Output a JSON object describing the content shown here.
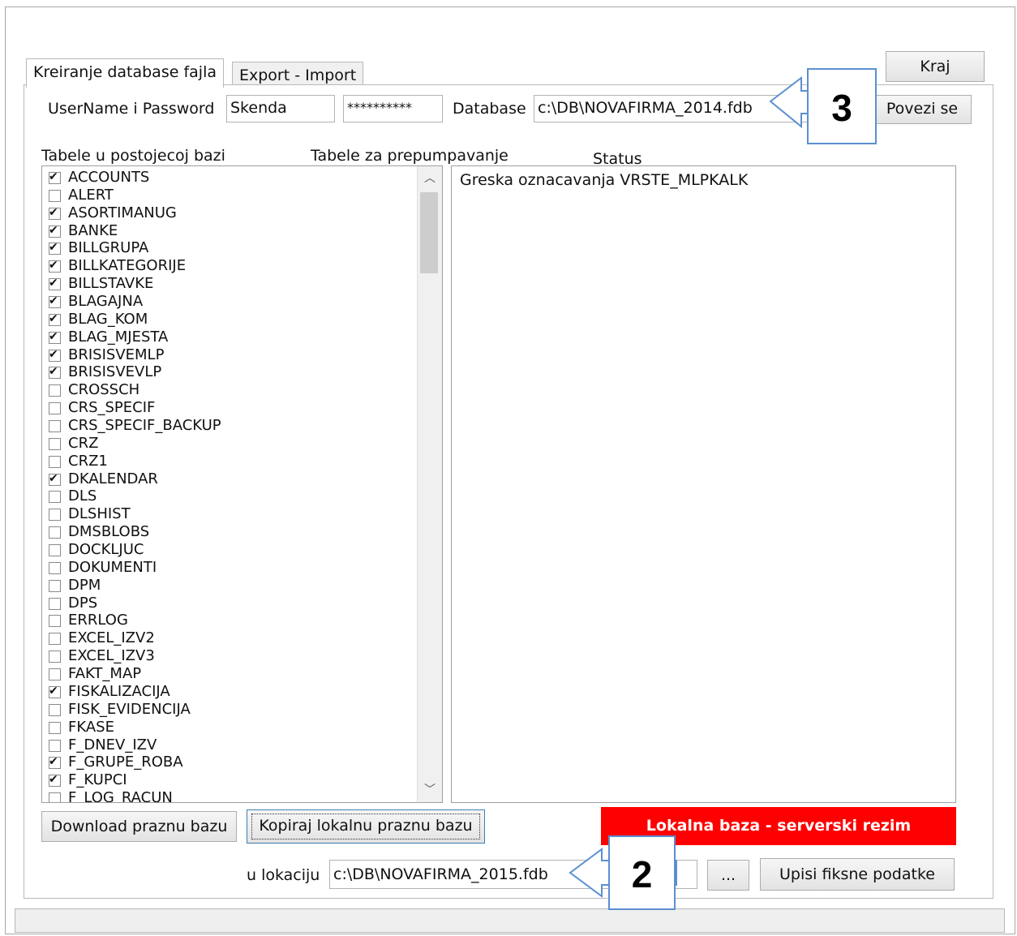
{
  "tabs": [
    "Kreiranje database fajla",
    "Export - Import"
  ],
  "kraj_label": "Kraj",
  "userpass_label": "UserName i Password",
  "username_value": "Skenda",
  "password_value": "**********",
  "database_label": "Database",
  "database_value": "c:\\DB\\NOVAFIRMA_2014.fdb",
  "povezi_label": "Povezi se",
  "col_existing": "Tabele u postojecoj bazi",
  "col_pump": "Tabele za prepumpavanje",
  "col_status": "Status",
  "status_text": "Greska oznacavanja VRSTE_MLPKALK",
  "download_label": "Download praznu bazu",
  "kopiraj_label": "Kopiraj lokalnu praznu bazu",
  "banner_text": "Lokalna baza - serverski rezim",
  "lokacija_label": "u lokaciju",
  "lokacija_value": "c:\\DB\\NOVAFIRMA_2015.fdb",
  "browse_label": "...",
  "upisi_label": "Upisi fiksne podatke",
  "callout_3": "3",
  "callout_2": "2",
  "tables": [
    {
      "name": "ACCOUNTS",
      "checked": true
    },
    {
      "name": "ALERT",
      "checked": false
    },
    {
      "name": "ASORTIMANUG",
      "checked": true
    },
    {
      "name": "BANKE",
      "checked": true
    },
    {
      "name": "BILLGRUPA",
      "checked": true
    },
    {
      "name": "BILLKATEGORIJE",
      "checked": true
    },
    {
      "name": "BILLSTAVKE",
      "checked": true
    },
    {
      "name": "BLAGAJNA",
      "checked": true
    },
    {
      "name": "BLAG_KOM",
      "checked": true
    },
    {
      "name": "BLAG_MJESTA",
      "checked": true
    },
    {
      "name": "BRISISVEMLP",
      "checked": true
    },
    {
      "name": "BRISISVEVLP",
      "checked": true
    },
    {
      "name": "CROSSCH",
      "checked": false
    },
    {
      "name": "CRS_SPECIF",
      "checked": false
    },
    {
      "name": "CRS_SPECIF_BACKUP",
      "checked": false
    },
    {
      "name": "CRZ",
      "checked": false
    },
    {
      "name": "CRZ1",
      "checked": false
    },
    {
      "name": "DKALENDAR",
      "checked": true
    },
    {
      "name": "DLS",
      "checked": false
    },
    {
      "name": "DLSHIST",
      "checked": false
    },
    {
      "name": "DMSBLOBS",
      "checked": false
    },
    {
      "name": "DOCKLJUC",
      "checked": false
    },
    {
      "name": "DOKUMENTI",
      "checked": false
    },
    {
      "name": "DPM",
      "checked": false
    },
    {
      "name": "DPS",
      "checked": false
    },
    {
      "name": "ERRLOG",
      "checked": false
    },
    {
      "name": "EXCEL_IZV2",
      "checked": false
    },
    {
      "name": "EXCEL_IZV3",
      "checked": false
    },
    {
      "name": "FAKT_MAP",
      "checked": false
    },
    {
      "name": "FISKALIZACIJA",
      "checked": true
    },
    {
      "name": "FISK_EVIDENCIJA",
      "checked": false
    },
    {
      "name": "FKASE",
      "checked": false
    },
    {
      "name": "F_DNEV_IZV",
      "checked": false
    },
    {
      "name": "F_GRUPE_ROBA",
      "checked": true
    },
    {
      "name": "F_KUPCI",
      "checked": true
    },
    {
      "name": "F_LOG_RACUN",
      "checked": false
    }
  ]
}
